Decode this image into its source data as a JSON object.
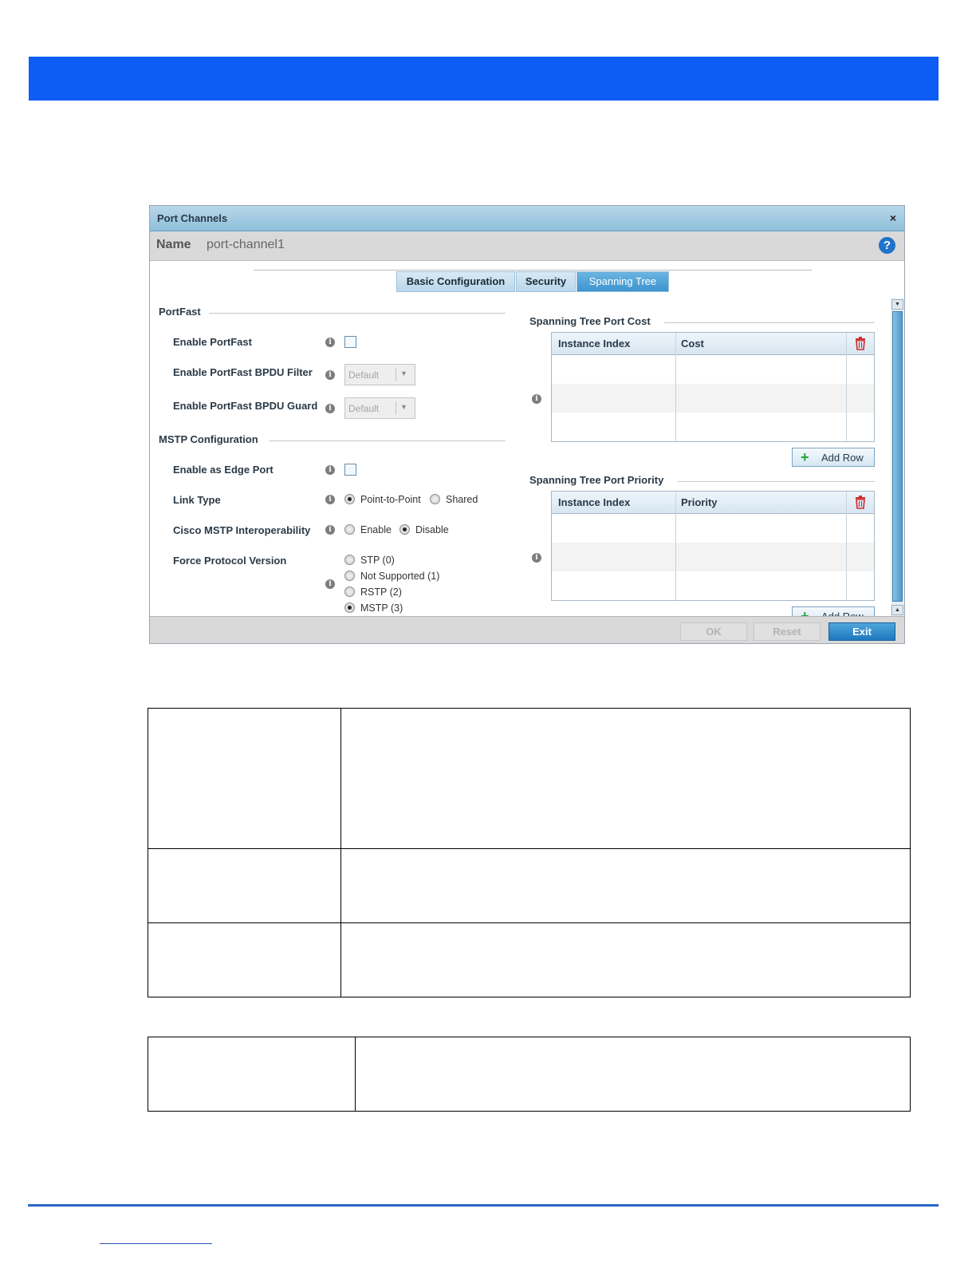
{
  "dialog": {
    "title": "Port Channels",
    "close_glyph": "×",
    "name_label": "Name",
    "name_value": "port-channel1",
    "help_glyph": "?"
  },
  "tabs": [
    {
      "label": "Basic Configuration",
      "active": false
    },
    {
      "label": "Security",
      "active": false
    },
    {
      "label": "Spanning Tree",
      "active": true
    }
  ],
  "portfast": {
    "section": "PortFast",
    "enable_portfast": {
      "label": "Enable PortFast",
      "checked": false
    },
    "bpdu_filter": {
      "label": "Enable PortFast BPDU Filter",
      "value": "Default"
    },
    "bpdu_guard": {
      "label": "Enable PortFast BPDU Guard",
      "value": "Default"
    }
  },
  "mstp": {
    "section": "MSTP Configuration",
    "edge_port": {
      "label": "Enable as Edge Port",
      "checked": false
    },
    "link_type": {
      "label": "Link Type",
      "options": [
        "Point-to-Point",
        "Shared"
      ],
      "selected": "Point-to-Point"
    },
    "cisco_interop": {
      "label": "Cisco MSTP Interoperability",
      "options": [
        "Enable",
        "Disable"
      ],
      "selected": "Disable"
    },
    "force_protocol": {
      "label": "Force Protocol Version",
      "options": [
        "STP (0)",
        "Not Supported (1)",
        "RSTP (2)",
        "MSTP (3)"
      ],
      "selected": "MSTP (3)"
    }
  },
  "port_cost": {
    "section": "Spanning Tree Port Cost",
    "columns": [
      "Instance Index",
      "Cost"
    ],
    "rows": [],
    "add_label": "Add Row"
  },
  "port_priority": {
    "section": "Spanning Tree Port Priority",
    "columns": [
      "Instance Index",
      "Priority"
    ],
    "rows": [],
    "add_label": "Add Row"
  },
  "footer": {
    "ok_label": "OK",
    "reset_label": "Reset",
    "exit_label": "Exit"
  },
  "icons": {
    "info": "info-icon",
    "delete": "trash-icon",
    "add": "plus-icon",
    "help": "help-icon",
    "close": "close-icon"
  },
  "colors": {
    "header_band": "#0d5cf6",
    "active_tab": "#3d95cf",
    "exit_button": "#1f78be",
    "trash": "#d12b2b",
    "add_plus": "#22a33a"
  }
}
